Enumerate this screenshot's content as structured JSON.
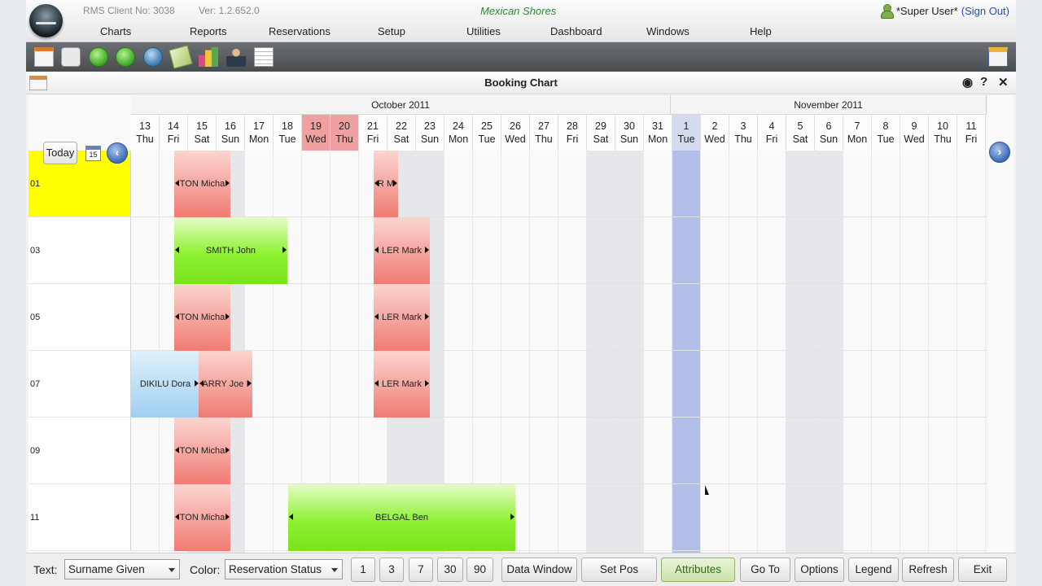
{
  "header": {
    "client_no": "RMS Client No: 3038",
    "version": "Ver: 1.2.652.0",
    "property": "Mexican Shores",
    "user": "*Super User*",
    "sign_out": "(Sign Out)"
  },
  "menu": [
    "Charts",
    "Reports",
    "Reservations",
    "Setup",
    "Utilities",
    "Dashboard",
    "Windows",
    "Help"
  ],
  "toolbar_icons": [
    "calendar-icon",
    "calendar-alt-icon",
    "refresh-icon",
    "add-icon",
    "globe-icon",
    "money-icon",
    "bar-chart-icon",
    "person-icon",
    "sheet-icon"
  ],
  "window": {
    "title": "Booking Chart",
    "help": "?",
    "close": "✕",
    "camera": "◉"
  },
  "chart": {
    "today_label": "Today",
    "cal_label": "15",
    "months": [
      "October 2011",
      "November 2011"
    ],
    "days": [
      {
        "n": "13",
        "d": "Thu"
      },
      {
        "n": "14",
        "d": "Fri"
      },
      {
        "n": "15",
        "d": "Sat"
      },
      {
        "n": "16",
        "d": "Sun"
      },
      {
        "n": "17",
        "d": "Mon"
      },
      {
        "n": "18",
        "d": "Tue"
      },
      {
        "n": "19",
        "d": "Wed"
      },
      {
        "n": "20",
        "d": "Thu"
      },
      {
        "n": "21",
        "d": "Fri"
      },
      {
        "n": "22",
        "d": "Sat"
      },
      {
        "n": "23",
        "d": "Sun"
      },
      {
        "n": "24",
        "d": "Mon"
      },
      {
        "n": "25",
        "d": "Tue"
      },
      {
        "n": "26",
        "d": "Wed"
      },
      {
        "n": "27",
        "d": "Thu"
      },
      {
        "n": "28",
        "d": "Fri"
      },
      {
        "n": "29",
        "d": "Sat"
      },
      {
        "n": "30",
        "d": "Sun"
      },
      {
        "n": "31",
        "d": "Mon"
      },
      {
        "n": "1",
        "d": "Tue"
      },
      {
        "n": "2",
        "d": "Wed"
      },
      {
        "n": "3",
        "d": "Thu"
      },
      {
        "n": "4",
        "d": "Fri"
      },
      {
        "n": "5",
        "d": "Sat"
      },
      {
        "n": "6",
        "d": "Sun"
      },
      {
        "n": "7",
        "d": "Mon"
      },
      {
        "n": "8",
        "d": "Tue"
      },
      {
        "n": "9",
        "d": "Wed"
      },
      {
        "n": "10",
        "d": "Thu"
      },
      {
        "n": "11",
        "d": "Fri"
      }
    ],
    "rooms": [
      "01",
      "03",
      "05",
      "07",
      "09",
      "11"
    ],
    "bookings": [
      {
        "room": "01",
        "start": "14",
        "label": "TON Micha",
        "status": "red"
      },
      {
        "room": "01",
        "start": "21",
        "label": "R M",
        "status": "red"
      },
      {
        "room": "03",
        "start": "14",
        "label": "SMITH John",
        "status": "green"
      },
      {
        "room": "03",
        "start": "21",
        "label": "LER Mark",
        "status": "red"
      },
      {
        "room": "05",
        "start": "14",
        "label": "TON Micha",
        "status": "red"
      },
      {
        "room": "05",
        "start": "21",
        "label": "LER Mark",
        "status": "red"
      },
      {
        "room": "07",
        "start": "13",
        "label": "DIKILU Dora",
        "status": "blue"
      },
      {
        "room": "07",
        "start": "15",
        "label": "ARRY Joe I",
        "status": "red"
      },
      {
        "room": "07",
        "start": "21",
        "label": "LER Mark",
        "status": "red"
      },
      {
        "room": "09",
        "start": "14",
        "label": "TON Micha",
        "status": "red"
      },
      {
        "room": "11",
        "start": "14",
        "label": "TON Micha",
        "status": "red"
      },
      {
        "room": "11",
        "start": "18",
        "label": "BELGAL Ben",
        "status": "green"
      }
    ]
  },
  "bottom": {
    "text_label": "Text:",
    "text_value": "Surname Given",
    "color_label": "Color:",
    "color_value": "Reservation Status",
    "buttons": [
      "1",
      "3",
      "7",
      "30",
      "90",
      "Data Window",
      "Set Pos",
      "Attributes",
      "Go To",
      "Options",
      "Legend",
      "Refresh",
      "Exit"
    ]
  },
  "colors": {
    "booking_red": "#f07b72",
    "booking_green": "#7be21e",
    "booking_blue": "#9fd0f1",
    "highlight": "#f0a0a0",
    "today_column": "#b3bfe8",
    "room_01": "#ffff00"
  }
}
